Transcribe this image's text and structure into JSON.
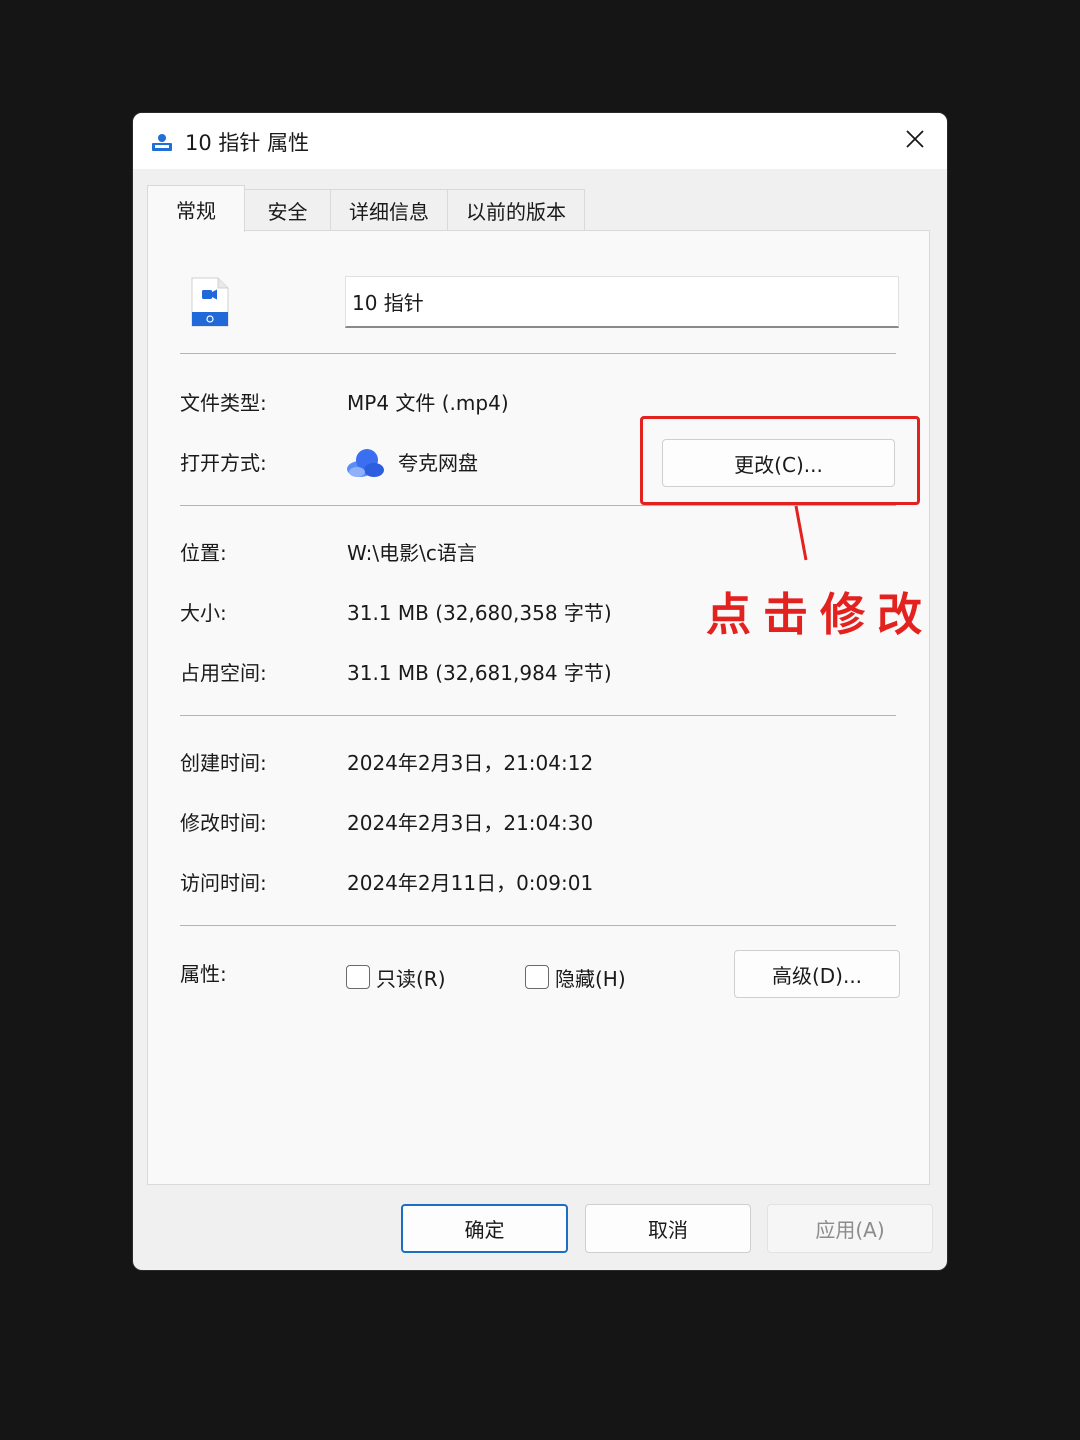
{
  "window": {
    "title": "10 指针 属性",
    "close_icon": "close-icon"
  },
  "tabs": [
    {
      "label": "常规",
      "active": true
    },
    {
      "label": "安全",
      "active": false
    },
    {
      "label": "详细信息",
      "active": false
    },
    {
      "label": "以前的版本",
      "active": false
    }
  ],
  "general": {
    "file_name": "10 指针",
    "file_icon": "video-file-icon",
    "file_type_label": "文件类型:",
    "file_type_value": "MP4 文件 (.mp4)",
    "open_with_label": "打开方式:",
    "open_with_app": "夸克网盘",
    "open_with_icon": "quark-cloud-icon",
    "change_button": "更改(C)...",
    "location_label": "位置:",
    "location_value": "W:\\电影\\c语言",
    "size_label": "大小:",
    "size_value": "31.1 MB (32,680,358 字节)",
    "size_on_disk_label": "占用空间:",
    "size_on_disk_value": "31.1 MB (32,681,984 字节)",
    "created_label": "创建时间:",
    "created_value": "2024年2月3日，21:04:12",
    "modified_label": "修改时间:",
    "modified_value": "2024年2月3日，21:04:30",
    "accessed_label": "访问时间:",
    "accessed_value": "2024年2月11日，0:09:01",
    "attributes_label": "属性:",
    "readonly_label": "只读(R)",
    "readonly_checked": false,
    "hidden_label": "隐藏(H)",
    "hidden_checked": false,
    "advanced_button": "高级(D)..."
  },
  "footer": {
    "ok_button": "确定",
    "cancel_button": "取消",
    "apply_button": "应用(A)",
    "apply_enabled": false
  },
  "annotation": {
    "text": "点击修改",
    "color": "#e3211e"
  },
  "colors": {
    "background": "#151515",
    "dialog": "#f0f0f0",
    "panel": "#f9f9f9",
    "primary_border": "#1a6fc4",
    "annotation": "#e3211e"
  }
}
